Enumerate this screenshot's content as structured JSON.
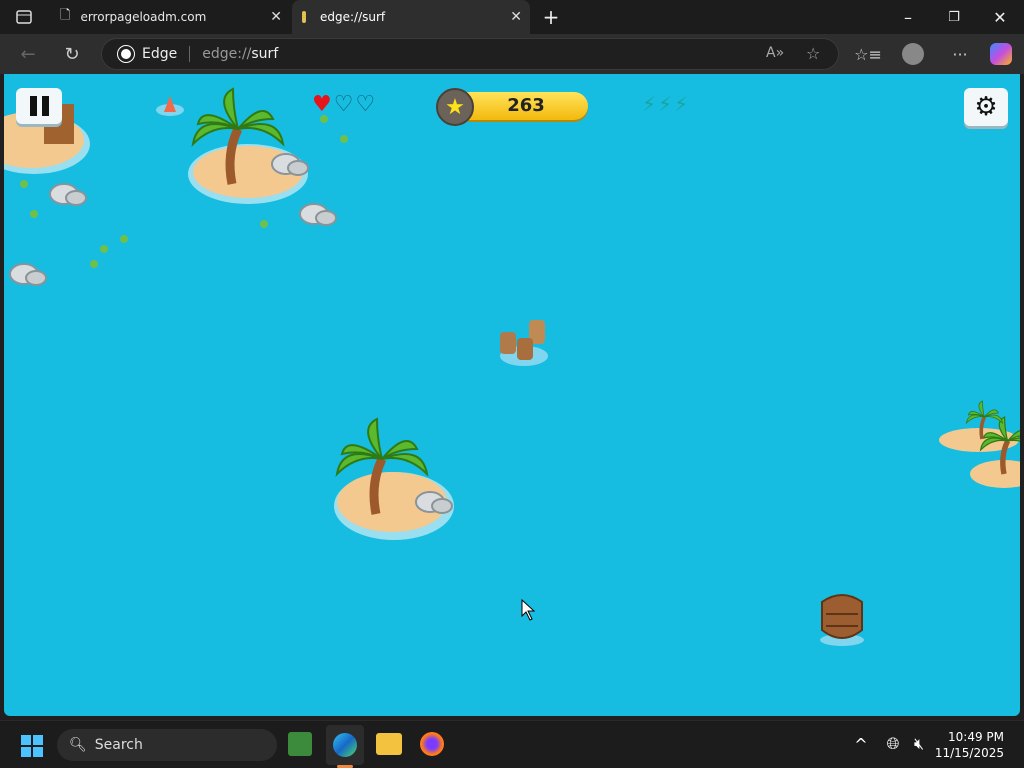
{
  "browser": {
    "tabs": [
      {
        "label": "errorpageloadm.com"
      },
      {
        "label": "edge://surf",
        "active": true
      }
    ],
    "address": {
      "site_label": "Edge",
      "url_prefix": "edge://",
      "url_main": "surf"
    }
  },
  "game": {
    "score": "263",
    "lives_total": 3,
    "lives_remaining": 1,
    "boosts_total": 3,
    "colors": {
      "water": "#16bde0",
      "heart": "#e8141c",
      "coin": "#f6c51a"
    }
  },
  "taskbar": {
    "search_placeholder": "Search",
    "time": "10:49 PM",
    "date": "11/15/2025"
  }
}
